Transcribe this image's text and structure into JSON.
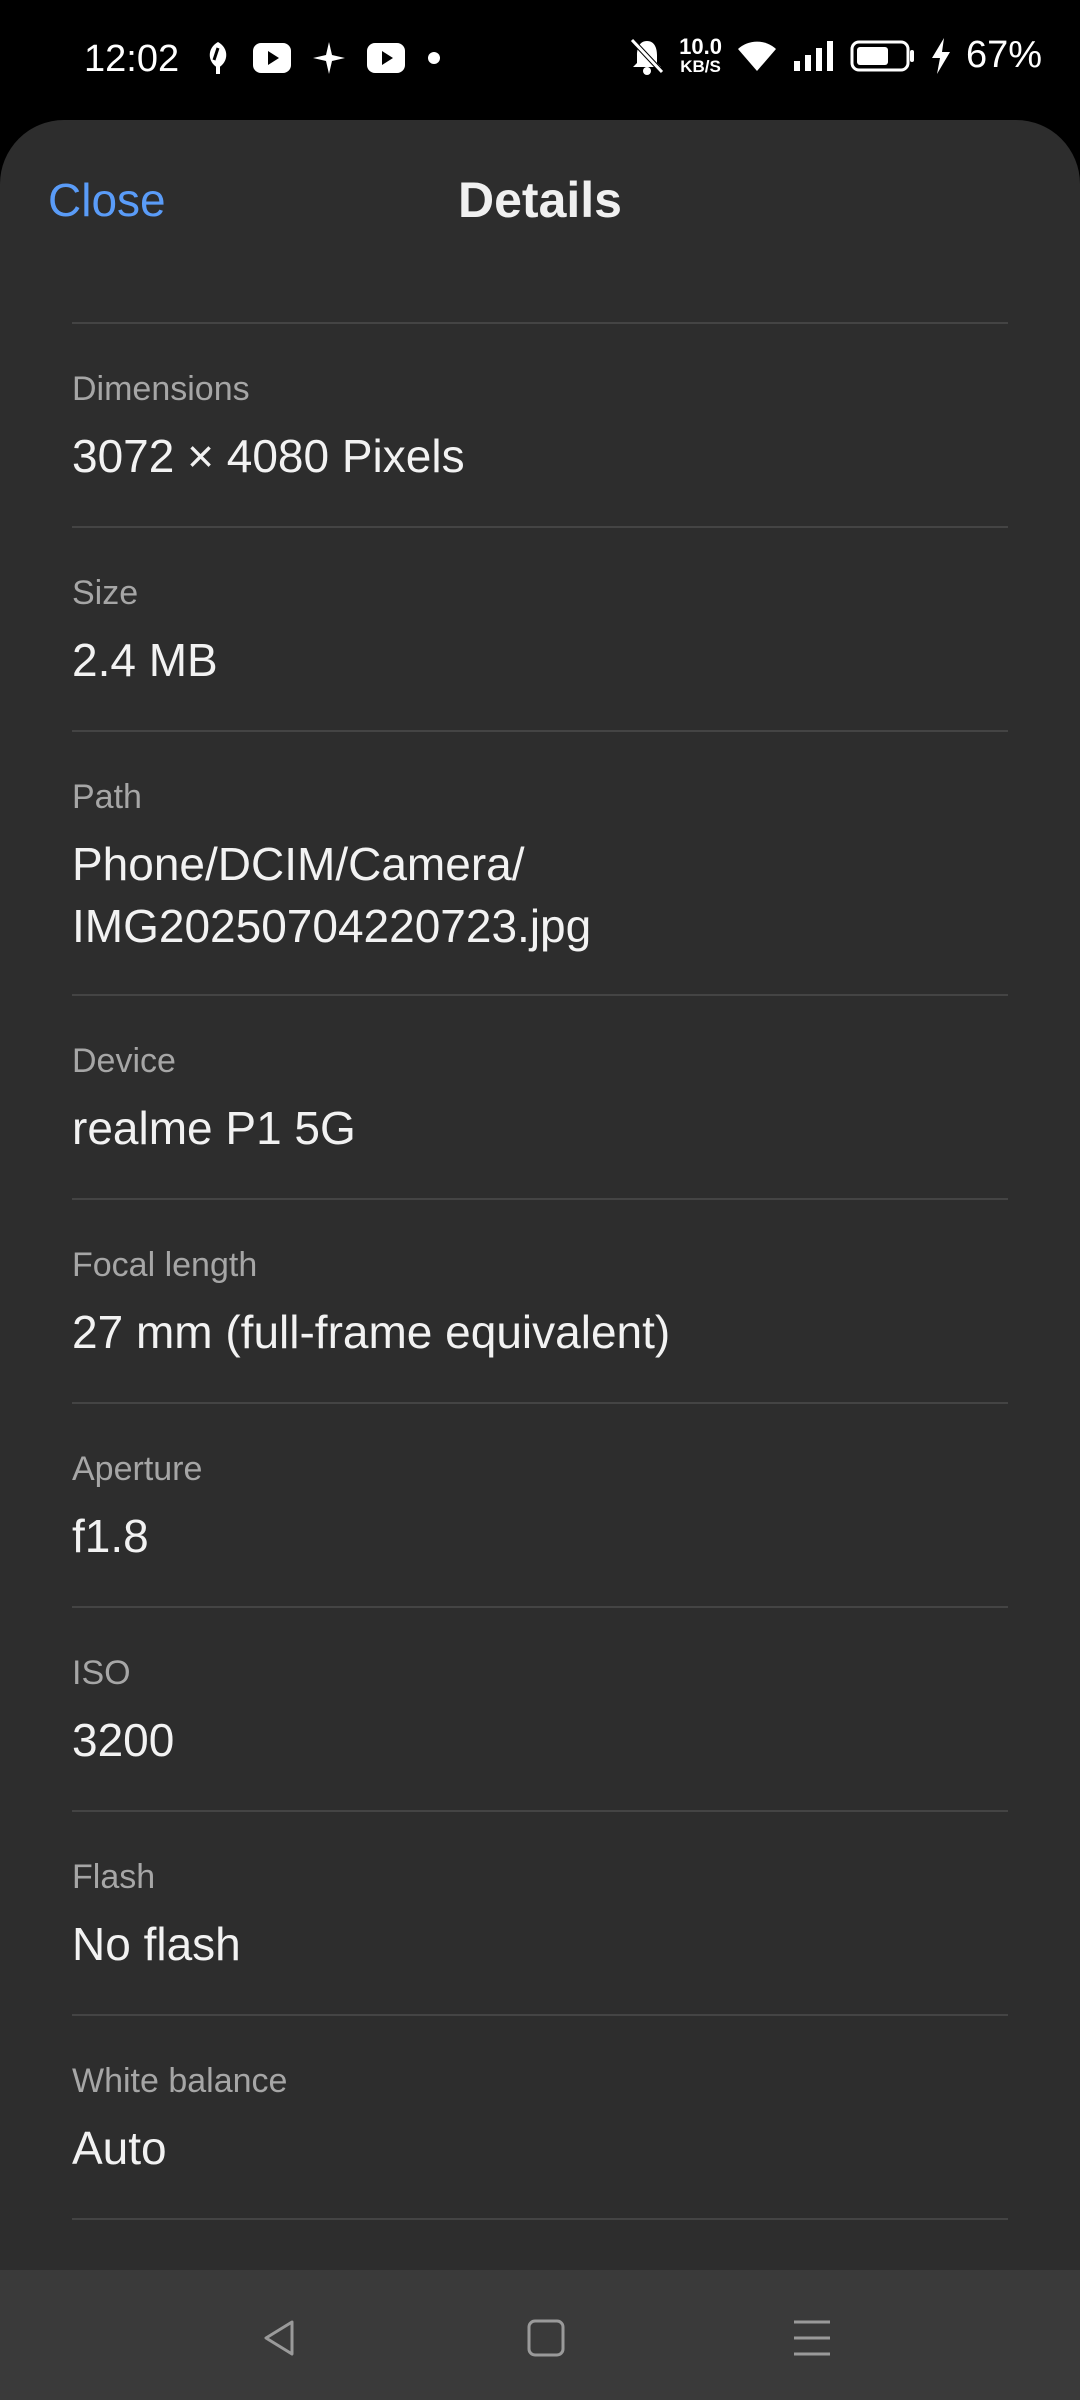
{
  "status_bar": {
    "time": "12:02",
    "left_icons": [
      "leaf-icon",
      "youtube-icon",
      "sparkle-icon",
      "youtube-icon",
      "dot-icon"
    ],
    "right_icons": [
      "mute-bell-icon",
      "wifi-icon",
      "signal-icon",
      "battery-icon",
      "charging-icon"
    ],
    "speed_value": "10.0",
    "speed_unit": "KB/S",
    "battery_percent": "67%",
    "battery_level": 0.67
  },
  "header": {
    "close_label": "Close",
    "title": "Details"
  },
  "details": [
    {
      "label": "Dimensions",
      "value": "3072 × 4080 Pixels"
    },
    {
      "label": "Size",
      "value": "2.4 MB"
    },
    {
      "label": "Path",
      "value": "Phone/DCIM/Camera/",
      "value2": "IMG20250704220723.jpg"
    },
    {
      "label": "Device",
      "value": "realme P1 5G"
    },
    {
      "label": "Focal length",
      "value": "27 mm (full-frame equivalent)"
    },
    {
      "label": "Aperture",
      "value": "f1.8"
    },
    {
      "label": "ISO",
      "value": "3200"
    },
    {
      "label": "Flash",
      "value": "No flash"
    },
    {
      "label": "White balance",
      "value": "Auto"
    }
  ],
  "nav": [
    "back-icon",
    "home-icon",
    "menu-icon"
  ],
  "colors": {
    "accent": "#5a9cf8",
    "sheet": "#2d2d2d",
    "navbar": "#3a3a3a"
  }
}
